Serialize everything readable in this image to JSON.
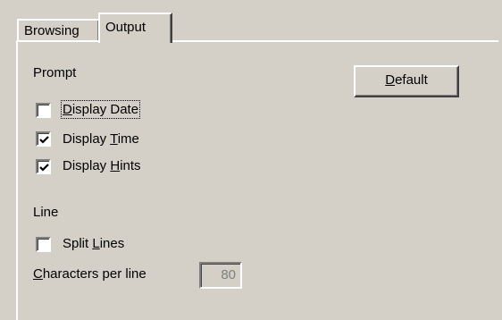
{
  "tabs": [
    {
      "label": "Browsing",
      "active": false
    },
    {
      "label": "Output",
      "active": true
    }
  ],
  "prompt_group": {
    "label": "Prompt",
    "options": [
      {
        "prefix": "",
        "mnemonic": "D",
        "suffix": "isplay Date",
        "checked": false,
        "focused": true
      },
      {
        "prefix": "Display ",
        "mnemonic": "T",
        "suffix": "ime",
        "checked": true,
        "focused": false
      },
      {
        "prefix": "Display ",
        "mnemonic": "H",
        "suffix": "ints",
        "checked": true,
        "focused": false
      }
    ]
  },
  "line_group": {
    "label": "Line",
    "split": {
      "prefix": "Split ",
      "mnemonic": "L",
      "suffix": "ines",
      "checked": false
    },
    "chars_label": {
      "mnemonic": "C",
      "suffix": "haracters per line"
    },
    "chars_value": "80",
    "chars_enabled": false
  },
  "default_button": {
    "mnemonic": "D",
    "suffix": "efault"
  },
  "icons": {
    "check": "checkmark-icon"
  }
}
